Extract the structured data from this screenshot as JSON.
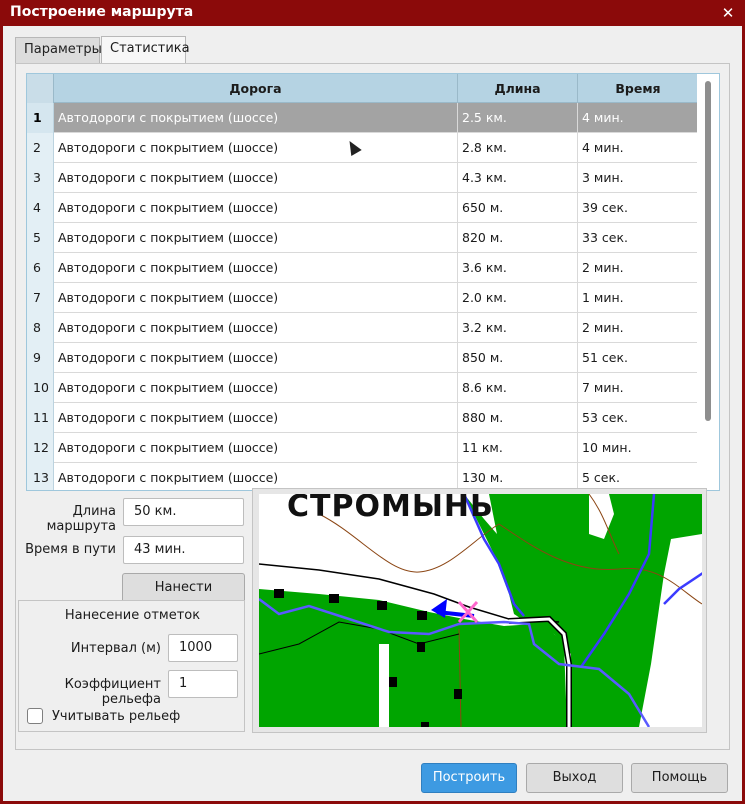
{
  "window": {
    "title": "Построение маршрута",
    "close_glyph": "✕"
  },
  "tabs": [
    {
      "label": "Параметры"
    },
    {
      "label": "Статистика"
    }
  ],
  "table": {
    "headers": {
      "road": "Дорога",
      "length": "Длина",
      "time": "Время"
    },
    "rows": [
      {
        "n": "1",
        "road": "Автодороги с покрытием (шоссе)",
        "length": "2.5 км.",
        "time": "4 мин."
      },
      {
        "n": "2",
        "road": "Автодороги с покрытием (шоссе)",
        "length": "2.8 км.",
        "time": "4 мин."
      },
      {
        "n": "3",
        "road": "Автодороги с покрытием (шоссе)",
        "length": "4.3 км.",
        "time": "3 мин."
      },
      {
        "n": "4",
        "road": "Автодороги с покрытием (шоссе)",
        "length": "650 м.",
        "time": "39 сек."
      },
      {
        "n": "5",
        "road": "Автодороги с покрытием (шоссе)",
        "length": "820 м.",
        "time": "33 сек."
      },
      {
        "n": "6",
        "road": "Автодороги с покрытием (шоссе)",
        "length": "3.6 км.",
        "time": "2 мин."
      },
      {
        "n": "7",
        "road": "Автодороги с покрытием (шоссе)",
        "length": "2.0 км.",
        "time": "1 мин."
      },
      {
        "n": "8",
        "road": "Автодороги с покрытием (шоссе)",
        "length": "3.2 км.",
        "time": "2 мин."
      },
      {
        "n": "9",
        "road": "Автодороги с покрытием (шоссе)",
        "length": "850 м.",
        "time": "51 сек."
      },
      {
        "n": "10",
        "road": "Автодороги с покрытием (шоссе)",
        "length": "8.6 км.",
        "time": "7 мин."
      },
      {
        "n": "11",
        "road": "Автодороги с покрытием (шоссе)",
        "length": "880 м.",
        "time": "53 сек."
      },
      {
        "n": "12",
        "road": "Автодороги с покрытием (шоссе)",
        "length": "11 км.",
        "time": "10 мин."
      },
      {
        "n": "13",
        "road": "Автодороги с покрытием (шоссе)",
        "length": "130 м.",
        "time": "5 сек."
      }
    ]
  },
  "summary": {
    "route_length_label": "Длина маршрута",
    "route_length_value": "50 км.",
    "travel_time_label": "Время в пути",
    "travel_time_value": "43 мин.",
    "plot_route_button": "Нанести маршрут"
  },
  "marks": {
    "group_title": "Нанесение отметок",
    "interval_label": "Интервал (м)",
    "interval_value": "1000",
    "relief_coef_label": "Коэффициент рельефа",
    "relief_coef_value": "1",
    "consider_relief_label": "Учитывать рельеф"
  },
  "map": {
    "place_label": "СТРОМЫНЬ"
  },
  "footer": {
    "build_button": "Построить",
    "exit_button": "Выход",
    "help_button": "Помощь"
  },
  "colors": {
    "title_bar": "#8b0a0a",
    "header": "#b5d3e3",
    "selected_row": "#a3a3a3",
    "primary_button": "#3d9ae2",
    "map_green": "#00a500",
    "route_blue": "#3b3bff"
  }
}
